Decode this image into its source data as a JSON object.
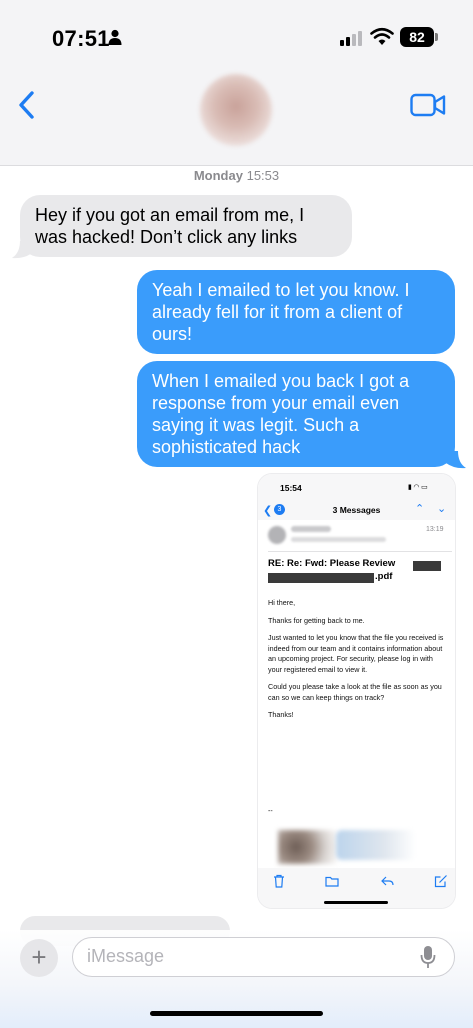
{
  "status_bar": {
    "time": "07:51",
    "battery": "82"
  },
  "thread": {
    "timestamp_day": "Monday",
    "timestamp_time": "15:53"
  },
  "messages": [
    {
      "direction": "incoming",
      "text": "Hey if you got an email from me, I was hacked! Don’t click any links"
    },
    {
      "direction": "outgoing",
      "text": "Yeah I emailed to let you know. I already fell for it from a client of ours!"
    },
    {
      "direction": "outgoing",
      "text": "When I emailed you back I got a response from your email even saying it was legit. Such a sophisticated hack"
    }
  ],
  "screenshot": {
    "status_time": "15:54",
    "back_count": "3",
    "title": "3 Messages",
    "time": "13:19",
    "subject": "RE: Re: Fwd: Please Review",
    "subject_suffix": ".pdf",
    "body": [
      "Hi there,",
      "Thanks for getting back to me.",
      "Just wanted to let you know that the file you received is indeed from our team and it contains information about an upcoming project. For security, please log in with your registered email to view it.",
      "Could you please take a look at the file as soon as you can so we can keep things on track?",
      "Thanks!"
    ],
    "signature_sep": "--"
  },
  "composer": {
    "placeholder": "iMessage",
    "plus_label": "+"
  },
  "colors": {
    "outgoing": "#3a9cfb",
    "incoming": "#e9e9eb",
    "accent": "#1d7cf2"
  }
}
